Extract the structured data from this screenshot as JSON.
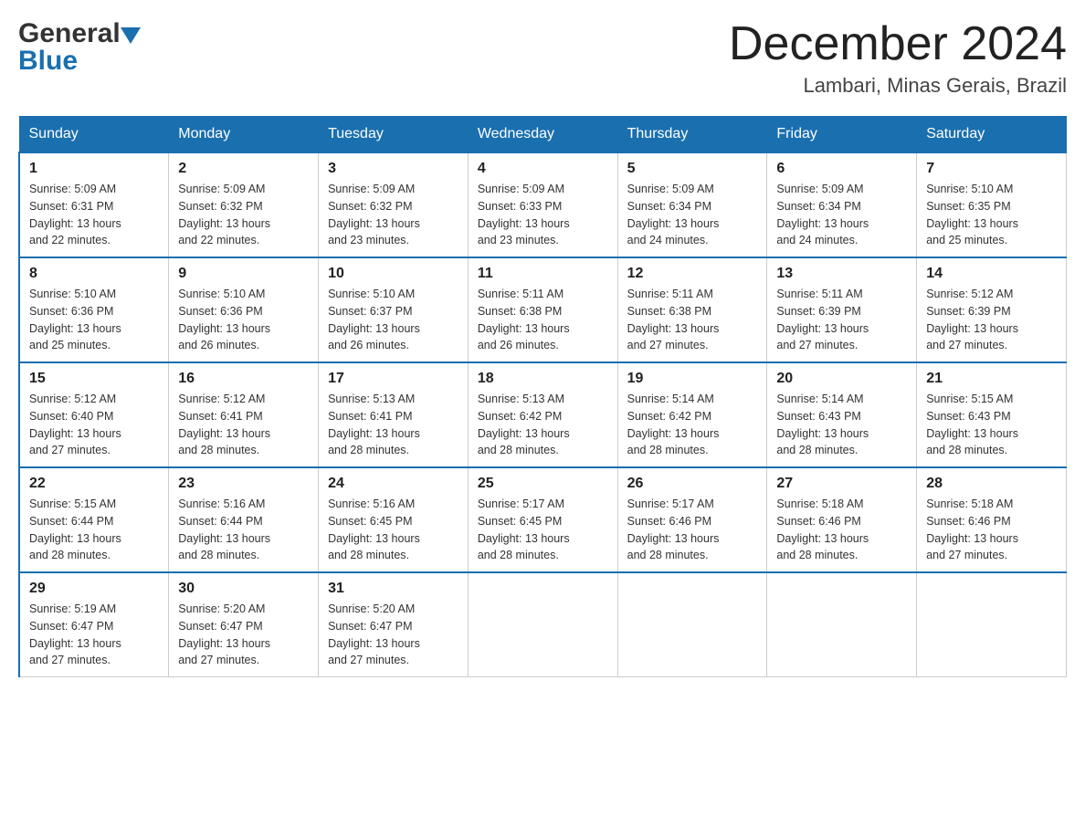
{
  "header": {
    "logo_general": "General",
    "logo_blue": "Blue",
    "month_title": "December 2024",
    "subtitle": "Lambari, Minas Gerais, Brazil"
  },
  "days_of_week": [
    "Sunday",
    "Monday",
    "Tuesday",
    "Wednesday",
    "Thursday",
    "Friday",
    "Saturday"
  ],
  "weeks": [
    [
      {
        "day": "1",
        "sunrise": "5:09 AM",
        "sunset": "6:31 PM",
        "daylight": "13 hours and 22 minutes."
      },
      {
        "day": "2",
        "sunrise": "5:09 AM",
        "sunset": "6:32 PM",
        "daylight": "13 hours and 22 minutes."
      },
      {
        "day": "3",
        "sunrise": "5:09 AM",
        "sunset": "6:32 PM",
        "daylight": "13 hours and 23 minutes."
      },
      {
        "day": "4",
        "sunrise": "5:09 AM",
        "sunset": "6:33 PM",
        "daylight": "13 hours and 23 minutes."
      },
      {
        "day": "5",
        "sunrise": "5:09 AM",
        "sunset": "6:34 PM",
        "daylight": "13 hours and 24 minutes."
      },
      {
        "day": "6",
        "sunrise": "5:09 AM",
        "sunset": "6:34 PM",
        "daylight": "13 hours and 24 minutes."
      },
      {
        "day": "7",
        "sunrise": "5:10 AM",
        "sunset": "6:35 PM",
        "daylight": "13 hours and 25 minutes."
      }
    ],
    [
      {
        "day": "8",
        "sunrise": "5:10 AM",
        "sunset": "6:36 PM",
        "daylight": "13 hours and 25 minutes."
      },
      {
        "day": "9",
        "sunrise": "5:10 AM",
        "sunset": "6:36 PM",
        "daylight": "13 hours and 26 minutes."
      },
      {
        "day": "10",
        "sunrise": "5:10 AM",
        "sunset": "6:37 PM",
        "daylight": "13 hours and 26 minutes."
      },
      {
        "day": "11",
        "sunrise": "5:11 AM",
        "sunset": "6:38 PM",
        "daylight": "13 hours and 26 minutes."
      },
      {
        "day": "12",
        "sunrise": "5:11 AM",
        "sunset": "6:38 PM",
        "daylight": "13 hours and 27 minutes."
      },
      {
        "day": "13",
        "sunrise": "5:11 AM",
        "sunset": "6:39 PM",
        "daylight": "13 hours and 27 minutes."
      },
      {
        "day": "14",
        "sunrise": "5:12 AM",
        "sunset": "6:39 PM",
        "daylight": "13 hours and 27 minutes."
      }
    ],
    [
      {
        "day": "15",
        "sunrise": "5:12 AM",
        "sunset": "6:40 PM",
        "daylight": "13 hours and 27 minutes."
      },
      {
        "day": "16",
        "sunrise": "5:12 AM",
        "sunset": "6:41 PM",
        "daylight": "13 hours and 28 minutes."
      },
      {
        "day": "17",
        "sunrise": "5:13 AM",
        "sunset": "6:41 PM",
        "daylight": "13 hours and 28 minutes."
      },
      {
        "day": "18",
        "sunrise": "5:13 AM",
        "sunset": "6:42 PM",
        "daylight": "13 hours and 28 minutes."
      },
      {
        "day": "19",
        "sunrise": "5:14 AM",
        "sunset": "6:42 PM",
        "daylight": "13 hours and 28 minutes."
      },
      {
        "day": "20",
        "sunrise": "5:14 AM",
        "sunset": "6:43 PM",
        "daylight": "13 hours and 28 minutes."
      },
      {
        "day": "21",
        "sunrise": "5:15 AM",
        "sunset": "6:43 PM",
        "daylight": "13 hours and 28 minutes."
      }
    ],
    [
      {
        "day": "22",
        "sunrise": "5:15 AM",
        "sunset": "6:44 PM",
        "daylight": "13 hours and 28 minutes."
      },
      {
        "day": "23",
        "sunrise": "5:16 AM",
        "sunset": "6:44 PM",
        "daylight": "13 hours and 28 minutes."
      },
      {
        "day": "24",
        "sunrise": "5:16 AM",
        "sunset": "6:45 PM",
        "daylight": "13 hours and 28 minutes."
      },
      {
        "day": "25",
        "sunrise": "5:17 AM",
        "sunset": "6:45 PM",
        "daylight": "13 hours and 28 minutes."
      },
      {
        "day": "26",
        "sunrise": "5:17 AM",
        "sunset": "6:46 PM",
        "daylight": "13 hours and 28 minutes."
      },
      {
        "day": "27",
        "sunrise": "5:18 AM",
        "sunset": "6:46 PM",
        "daylight": "13 hours and 28 minutes."
      },
      {
        "day": "28",
        "sunrise": "5:18 AM",
        "sunset": "6:46 PM",
        "daylight": "13 hours and 27 minutes."
      }
    ],
    [
      {
        "day": "29",
        "sunrise": "5:19 AM",
        "sunset": "6:47 PM",
        "daylight": "13 hours and 27 minutes."
      },
      {
        "day": "30",
        "sunrise": "5:20 AM",
        "sunset": "6:47 PM",
        "daylight": "13 hours and 27 minutes."
      },
      {
        "day": "31",
        "sunrise": "5:20 AM",
        "sunset": "6:47 PM",
        "daylight": "13 hours and 27 minutes."
      },
      null,
      null,
      null,
      null
    ]
  ],
  "labels": {
    "sunrise": "Sunrise:",
    "sunset": "Sunset:",
    "daylight": "Daylight:"
  },
  "colors": {
    "header_bg": "#1a6faf",
    "header_text": "#ffffff",
    "border": "#1a6faf",
    "cell_border": "#cccccc"
  }
}
